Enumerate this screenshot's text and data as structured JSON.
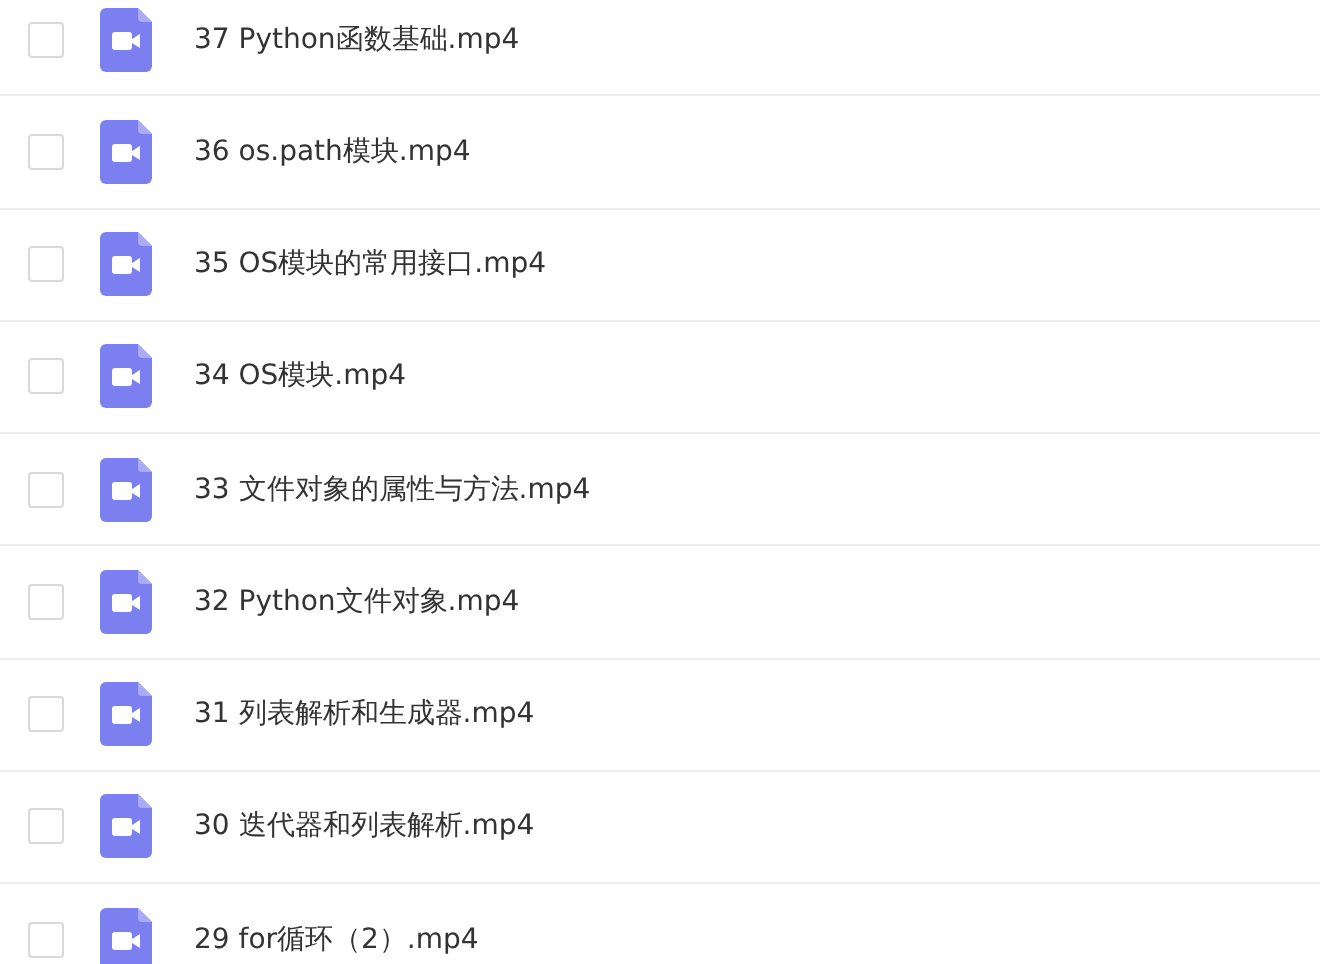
{
  "files": [
    {
      "name": "37 Python函数基础.mp4",
      "checked": false
    },
    {
      "name": "36 os.path模块.mp4",
      "checked": false
    },
    {
      "name": "35 OS模块的常用接口.mp4",
      "checked": false
    },
    {
      "name": "34 OS模块.mp4",
      "checked": false
    },
    {
      "name": "33 文件对象的属性与方法.mp4",
      "checked": false
    },
    {
      "name": "32 Python文件对象.mp4",
      "checked": false
    },
    {
      "name": "31 列表解析和生成器.mp4",
      "checked": false
    },
    {
      "name": "30 迭代器和列表解析.mp4",
      "checked": false
    },
    {
      "name": "29 for循环（2）.mp4",
      "checked": false
    }
  ]
}
